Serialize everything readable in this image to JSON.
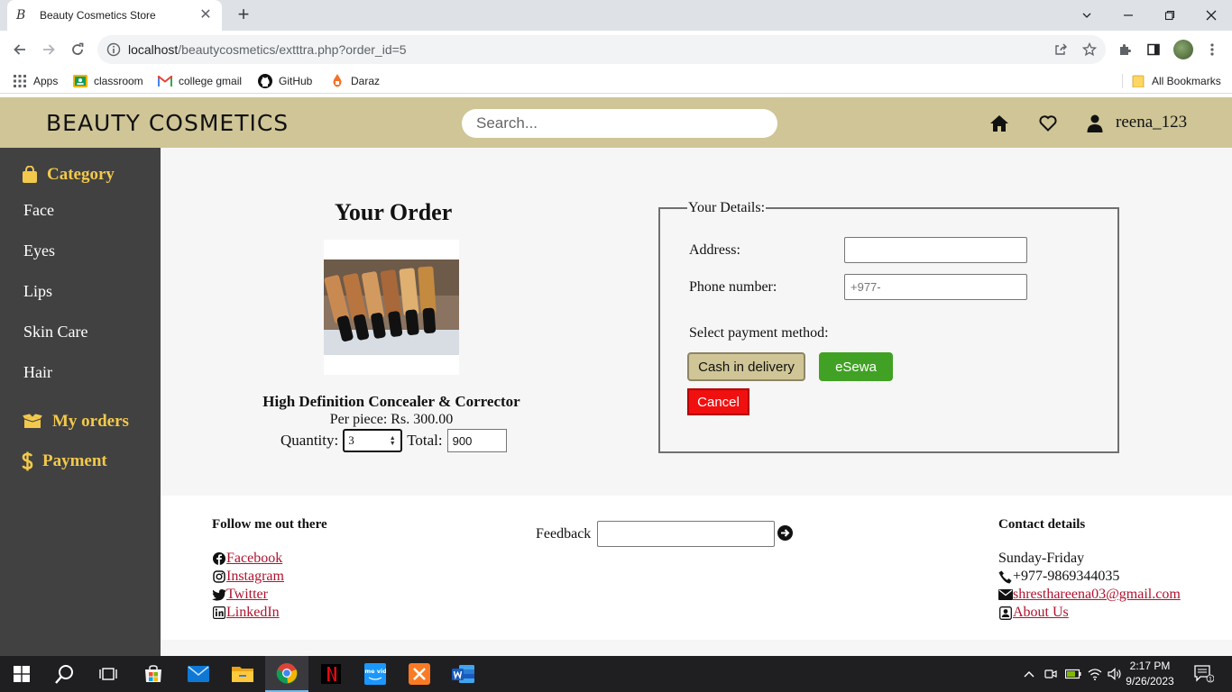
{
  "browser": {
    "tab_title": "Beauty Cosmetics Store",
    "tab_favicon": "B",
    "url_host": "localhost",
    "url_path": "/beautycosmetics/extttra.php?order_id=5",
    "bookmarks": [
      {
        "label": "Apps",
        "icon": "apps-grid-icon"
      },
      {
        "label": "classroom",
        "icon": "classroom-icon"
      },
      {
        "label": "college gmail",
        "icon": "gmail-icon"
      },
      {
        "label": "GitHub",
        "icon": "github-icon"
      },
      {
        "label": "Daraz",
        "icon": "daraz-icon"
      }
    ],
    "all_bookmarks": "All Bookmarks"
  },
  "header": {
    "brand": "BEAUTY COSMETICS",
    "search_placeholder": "Search...",
    "username": "reena_123"
  },
  "sidebar": {
    "category_label": "Category",
    "items": [
      "Face",
      "Eyes",
      "Lips",
      "Skin Care",
      "Hair"
    ],
    "my_orders_label": "My orders",
    "payment_label": "Payment"
  },
  "order": {
    "title": "Your Order",
    "product_name": "High Definition Concealer & Corrector",
    "per_piece": "Per piece: Rs. 300.00",
    "quantity_label": "Quantity:",
    "quantity_value": "3",
    "total_label": "Total:",
    "total_value": "900"
  },
  "details": {
    "legend": "Your Details:",
    "address_label": "Address:",
    "address_value": "",
    "phone_label": "Phone number:",
    "phone_placeholder": "+977-",
    "payment_method_label": "Select payment method:",
    "cod_label": "Cash in delivery",
    "esewa_label": "eSewa",
    "cancel_label": "Cancel"
  },
  "footer": {
    "follow_heading": "Follow me out there",
    "social_links": [
      "Facebook",
      "Instagram",
      "Twitter",
      "LinkedIn"
    ],
    "feedback_label": "Feedback",
    "contact_heading": "Contact details",
    "days": "Sunday-Friday",
    "phone": "+977-9869344035",
    "email": "shresthareena03@gmail.com",
    "about": "About Us"
  },
  "taskbar": {
    "time": "2:17 PM",
    "date": "9/26/2023",
    "notification_count": "1",
    "prime_label": "prime video"
  },
  "colors": {
    "header_bg": "#cfc596",
    "sidebar_bg": "#414141",
    "sidebar_accent": "#f2c94c",
    "esewa_green": "#41a124",
    "cancel_red": "#f01010",
    "link_color": "#b0122e"
  }
}
